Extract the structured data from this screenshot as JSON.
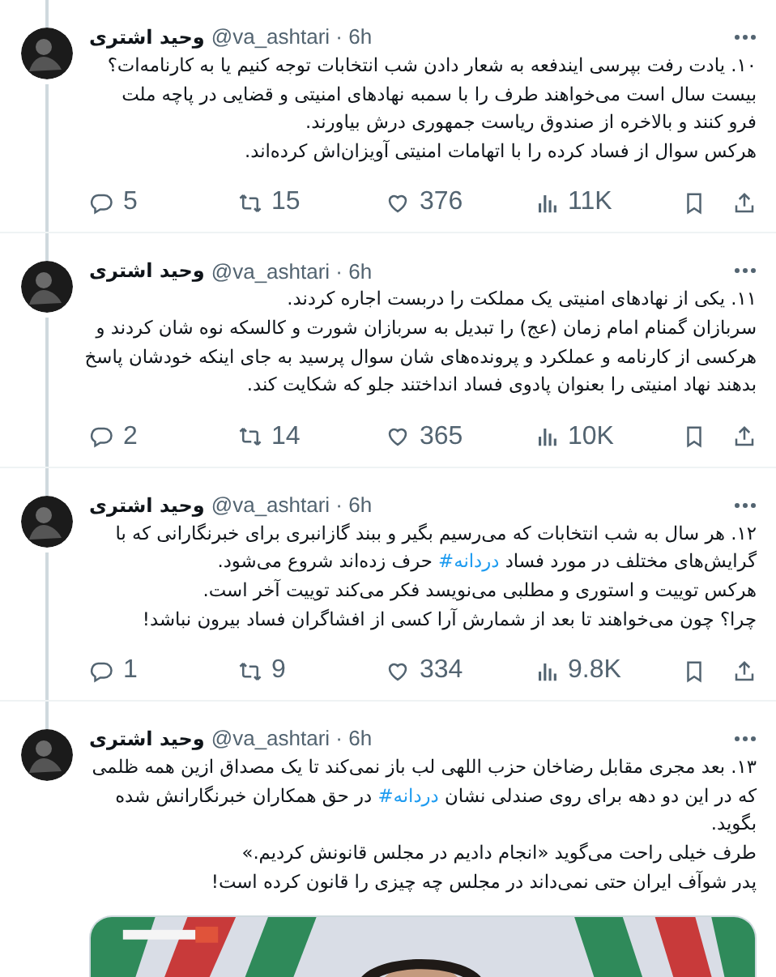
{
  "tweets": [
    {
      "author": "وحید اشتری",
      "meta": "@va_ashtari · 6h",
      "lines": [
        {
          "text": "۱۰. یادت رفت بپرسی ایندفعه به شعار دادن شب انتخابات توجه کنیم یا به کارنامه‌ات؟"
        },
        {
          "text": "بیست سال است می‌خواهند طرف را با سمبه نهادهای امنیتی و قضایی در پاچه ملت"
        },
        {
          "text": "فرو کنند و بالاخره از صندوق ریاست جمهوری درش بیاورند."
        },
        {
          "text": "هرکس سوال از فساد کرده را با اتهامات امنیتی آویزان‌اش کرده‌اند."
        }
      ],
      "stats": {
        "replies": "5",
        "retweets": "15",
        "likes": "376",
        "views": "11K"
      }
    },
    {
      "author": "وحید اشتری",
      "meta": "@va_ashtari · 6h",
      "lines": [
        {
          "text": "۱۱. یکی از نهادهای امنیتی یک مملکت را دربست اجاره کردند."
        },
        {
          "text": "سربازان گمنام امام زمان (عج) را تبدیل به سربازان شورت و کالسکه نوه شان کردند و"
        },
        {
          "text": "هرکسی از کارنامه و عملکرد و پرونده‌های شان سوال پرسید به جای اینکه خودشان پاسخ"
        },
        {
          "text": "بدهند نهاد امنیتی را بعنوان پادوی فساد انداختند جلو که شکایت کند."
        }
      ],
      "stats": {
        "replies": "2",
        "retweets": "14",
        "likes": "365",
        "views": "10K"
      }
    },
    {
      "author": "وحید اشتری",
      "meta": "@va_ashtari · 6h",
      "lines": [
        {
          "text": "۱۲. هر سال به شب انتخابات که می‌رسیم بگیر و ببند گازانبری برای خبرنگارانی که با"
        },
        {
          "text": "گرایش‌های مختلف در مورد فساد",
          "hashtag": "#دردانه",
          "after": "حرف زده‌اند شروع می‌شود."
        },
        {
          "text": "هرکس توییت و استوری و مطلبی می‌نویسد فکر می‌کند توییت آخر است."
        },
        {
          "text": "چرا؟ چون می‌خواهند تا بعد از شمارش آرا کسی از افشاگران فساد بیرون نباشد!"
        }
      ],
      "stats": {
        "replies": "1",
        "retweets": "9",
        "likes": "334",
        "views": "9.8K"
      }
    },
    {
      "author": "وحید اشتری",
      "meta": "@va_ashtari · 6h",
      "lines": [
        {
          "text": "۱۳. بعد مجری مقابل رضاخان حزب اللهی لب باز نمی‌کند تا یک مصداق ازین همه ظلمی"
        },
        {
          "text": "که در این دو دهه برای روی صندلی نشان",
          "hashtag": "#دردانه",
          "after": "در حق همکاران خبرنگارانش شده"
        },
        {
          "text": "بگوید."
        },
        {
          "text": "طرف خیلی راحت می‌گوید «انجام دادیم در مجلس قانونش کردیم.»"
        },
        {
          "text": "پدر شوآف ایران حتی نمی‌داند در مجلس چه چیزی را قانون کرده است!"
        }
      ]
    }
  ]
}
